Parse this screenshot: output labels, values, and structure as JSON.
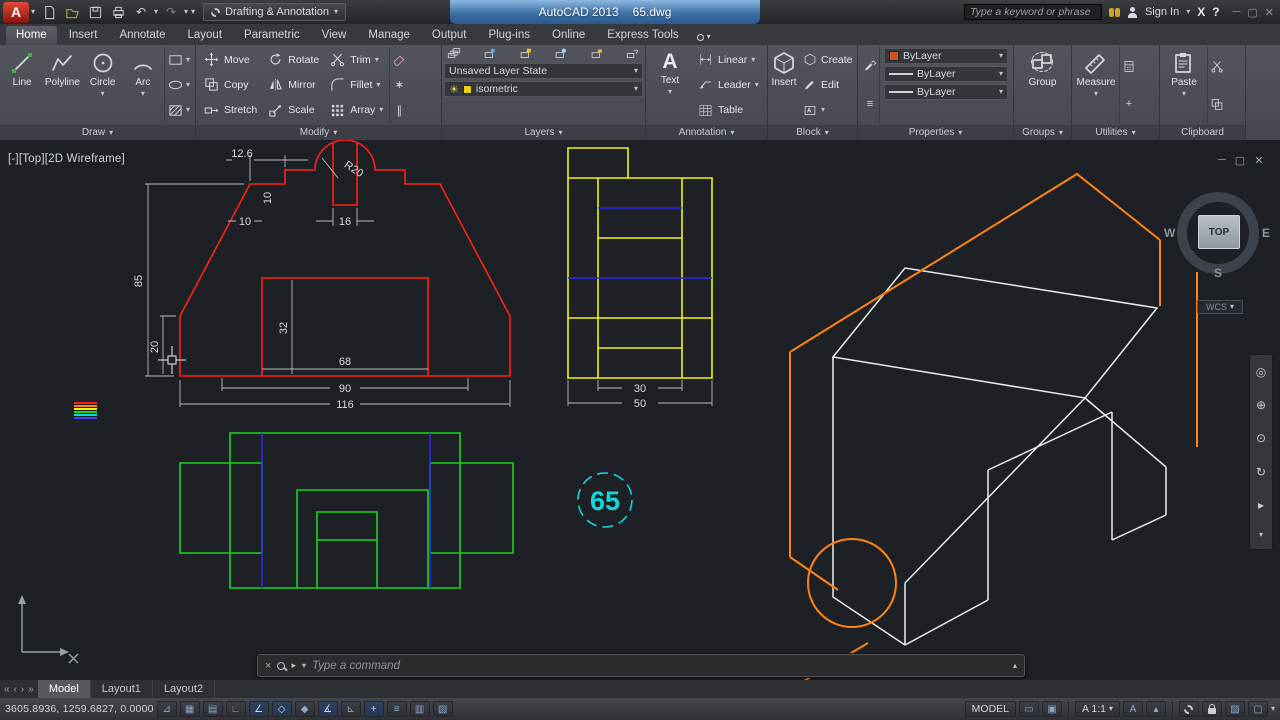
{
  "colors": {
    "red": "#ff2015",
    "yellow": "#f2f20c",
    "green": "#1bd41b",
    "cyan": "#15d6d6",
    "blue": "#2a2aee",
    "orange": "#ff8312"
  },
  "titlebar": {
    "logo_letter": "A",
    "workspace": "Drafting & Annotation",
    "app_title": "AutoCAD 2013",
    "doc_name": "65.dwg",
    "search_placeholder": "Type a keyword or phrase",
    "sign_in": "Sign In"
  },
  "ribbon": {
    "tabs": [
      "Home",
      "Insert",
      "Annotate",
      "Layout",
      "Parametric",
      "View",
      "Manage",
      "Output",
      "Plug-ins",
      "Online",
      "Express Tools"
    ],
    "panels": {
      "draw": {
        "title": "Draw",
        "tools": [
          "Line",
          "Polyline",
          "Circle",
          "Arc"
        ]
      },
      "modify": {
        "title": "Modify",
        "tools": [
          "Move",
          "Copy",
          "Stretch",
          "Rotate",
          "Mirror",
          "Scale",
          "Trim",
          "Fillet",
          "Array"
        ]
      },
      "layers": {
        "title": "Layers",
        "layer_state": "Unsaved Layer State",
        "current_layer": "isometric"
      },
      "annotation": {
        "title": "Annotation",
        "tools": [
          "Text",
          "Linear",
          "Leader",
          "Table"
        ]
      },
      "block": {
        "title": "Block",
        "tools": [
          "Insert",
          "Create",
          "Edit"
        ]
      },
      "properties": {
        "title": "Properties",
        "rows": [
          "ByLayer",
          "ByLayer",
          "ByLayer"
        ]
      },
      "groups": {
        "title": "Groups",
        "tools": [
          "Group"
        ]
      },
      "utilities": {
        "title": "Utilities",
        "tools": [
          "Measure"
        ]
      },
      "clipboard": {
        "title": "Clipboard",
        "tools": [
          "Paste"
        ]
      }
    }
  },
  "viewport": {
    "label": "[-][Top][2D Wireframe]",
    "viewcube": {
      "top": "TOP",
      "west": "W",
      "east": "E",
      "south": "S",
      "wcs": "WCS"
    },
    "front_dims": {
      "top_width": "12.6",
      "radius": "R20",
      "step_height": "10",
      "shoulder_width": "10",
      "notch_width": "16",
      "height": "85",
      "base_height": "20",
      "opening_height": "32",
      "opening_width": "68",
      "middle_width": "90",
      "total_width": "116"
    },
    "side_dims": {
      "inner_width": "30",
      "outer_width": "50"
    },
    "callout": "65"
  },
  "command_line": {
    "prompt": "Type a command"
  },
  "layout_tabs": [
    "Model",
    "Layout1",
    "Layout2"
  ],
  "status_bar": {
    "coordinates": "3605.8936, 1259.6827, 0.0000",
    "model_label": "MODEL",
    "annotation_scale": "A 1:1"
  }
}
